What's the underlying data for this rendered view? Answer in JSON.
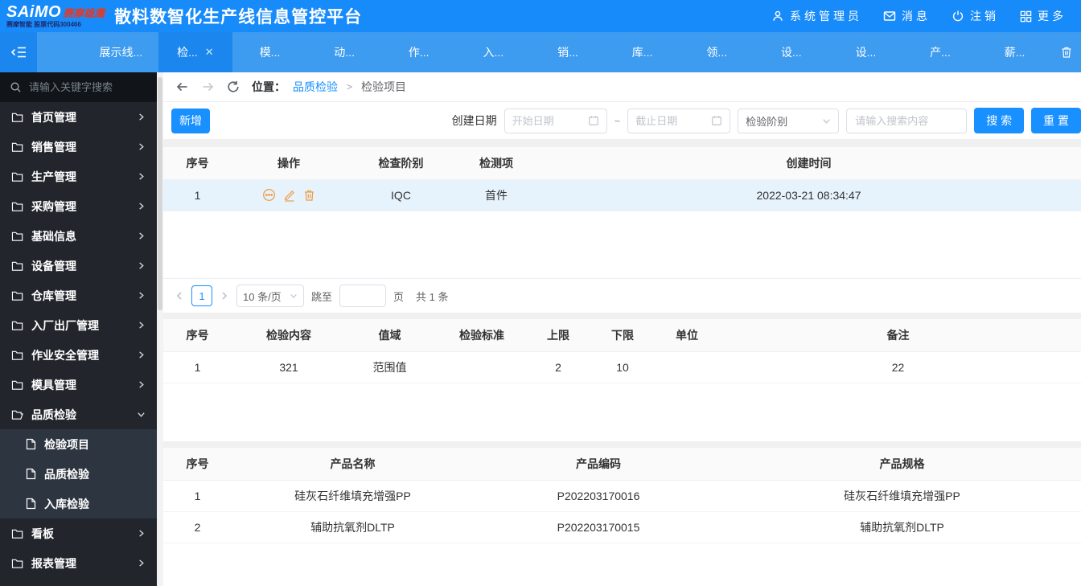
{
  "brand": {
    "logo_main": "SAiMO",
    "logo_accent": "赛摩雄鹰",
    "logo_sub": "赛摩智能 股票代码300466",
    "app_title": "散料数智化生产线信息管控平台"
  },
  "header": {
    "user_label": "系统管理员",
    "messages_label": "消息",
    "logout_label": "注销",
    "more_label": "更多"
  },
  "tabbar": {
    "close_glyph": "✕",
    "tabs": [
      {
        "label": "展示线..."
      },
      {
        "label": "检...",
        "active": true
      },
      {
        "label": "模..."
      },
      {
        "label": "动..."
      },
      {
        "label": "作..."
      },
      {
        "label": "入..."
      },
      {
        "label": "销..."
      },
      {
        "label": "库..."
      },
      {
        "label": "领..."
      },
      {
        "label": "设..."
      },
      {
        "label": "设..."
      },
      {
        "label": "产..."
      },
      {
        "label": "薪..."
      }
    ]
  },
  "sidebar": {
    "search_placeholder": "请输入关键字搜索",
    "items": [
      {
        "label": "首页管理"
      },
      {
        "label": "销售管理"
      },
      {
        "label": "生产管理"
      },
      {
        "label": "采购管理"
      },
      {
        "label": "基础信息"
      },
      {
        "label": "设备管理"
      },
      {
        "label": "仓库管理"
      },
      {
        "label": "入厂出厂管理"
      },
      {
        "label": "作业安全管理"
      },
      {
        "label": "模具管理"
      },
      {
        "label": "品质检验",
        "expanded": true
      },
      {
        "label": "看板"
      },
      {
        "label": "报表管理"
      }
    ],
    "quality_children": [
      {
        "label": "检验项目"
      },
      {
        "label": "品质检验"
      },
      {
        "label": "入库检验"
      }
    ]
  },
  "breadcrumb": {
    "location_label": "位置：",
    "parent": "品质检验",
    "separator": ">",
    "current": "检验项目"
  },
  "toolbar": {
    "add_button": "新增",
    "date_label": "创建日期",
    "start_placeholder": "开始日期",
    "range_separator": "~",
    "end_placeholder": "截止日期",
    "stage_placeholder": "检验阶别",
    "keyword_placeholder": "请输入搜索内容",
    "search_button": "搜 索",
    "reset_button": "重 置"
  },
  "inspection_table": {
    "headers": [
      "序号",
      "操作",
      "检查阶别",
      "检测项",
      "创建时间"
    ],
    "rows": [
      {
        "seq": "1",
        "stage": "IQC",
        "item": "首件",
        "created": "2022-03-21 08:34:47"
      }
    ]
  },
  "pagination": {
    "page": "1",
    "page_size": "10 条/页",
    "jump_label": "跳至",
    "jump_unit": "页",
    "total": "共 1 条"
  },
  "detail_table": {
    "headers": [
      "序号",
      "检验内容",
      "值域",
      "检验标准",
      "上限",
      "下限",
      "单位",
      "备注"
    ],
    "rows": [
      {
        "seq": "1",
        "content": "321",
        "domain": "范围值",
        "standard": "",
        "upper": "2",
        "lower": "10",
        "unit": "",
        "remark": "22"
      }
    ]
  },
  "product_table": {
    "headers": [
      "序号",
      "产品名称",
      "产品编码",
      "产品规格"
    ],
    "rows": [
      {
        "seq": "1",
        "name": "硅灰石纤维填充增强PP",
        "code": "P202203170016",
        "spec": "硅灰石纤维填充增强PP"
      },
      {
        "seq": "2",
        "name": "辅助抗氧剂DLTP",
        "code": "P202203170015",
        "spec": "辅助抗氧剂DLTP"
      }
    ]
  },
  "colors": {
    "header_blue": "#188bfa",
    "tabbar_blue": "#3d9bf0",
    "active_tab_blue": "#1a86ee",
    "primary_button": "#1890ff",
    "link_blue": "#1890ff",
    "action_icon_orange": "#ef9b41",
    "sidebar_dark": "#22262c",
    "selected_row_blue": "#e6f3fd"
  }
}
